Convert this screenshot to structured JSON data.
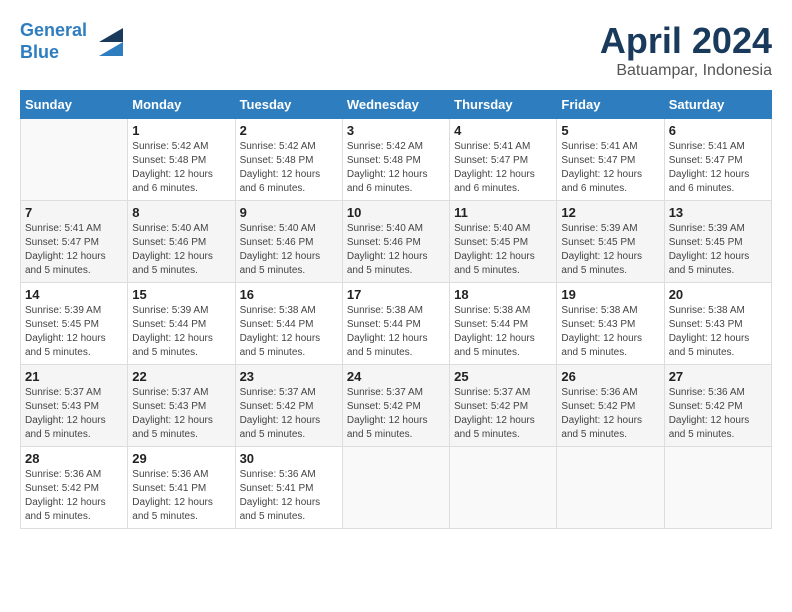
{
  "header": {
    "logo_line1": "General",
    "logo_line2": "Blue",
    "title": "April 2024",
    "subtitle": "Batuampar, Indonesia"
  },
  "columns": [
    "Sunday",
    "Monday",
    "Tuesday",
    "Wednesday",
    "Thursday",
    "Friday",
    "Saturday"
  ],
  "weeks": [
    [
      {
        "day": "",
        "info": ""
      },
      {
        "day": "1",
        "info": "Sunrise: 5:42 AM\nSunset: 5:48 PM\nDaylight: 12 hours\nand 6 minutes."
      },
      {
        "day": "2",
        "info": "Sunrise: 5:42 AM\nSunset: 5:48 PM\nDaylight: 12 hours\nand 6 minutes."
      },
      {
        "day": "3",
        "info": "Sunrise: 5:42 AM\nSunset: 5:48 PM\nDaylight: 12 hours\nand 6 minutes."
      },
      {
        "day": "4",
        "info": "Sunrise: 5:41 AM\nSunset: 5:47 PM\nDaylight: 12 hours\nand 6 minutes."
      },
      {
        "day": "5",
        "info": "Sunrise: 5:41 AM\nSunset: 5:47 PM\nDaylight: 12 hours\nand 6 minutes."
      },
      {
        "day": "6",
        "info": "Sunrise: 5:41 AM\nSunset: 5:47 PM\nDaylight: 12 hours\nand 6 minutes."
      }
    ],
    [
      {
        "day": "7",
        "info": "Sunrise: 5:41 AM\nSunset: 5:47 PM\nDaylight: 12 hours\nand 5 minutes."
      },
      {
        "day": "8",
        "info": "Sunrise: 5:40 AM\nSunset: 5:46 PM\nDaylight: 12 hours\nand 5 minutes."
      },
      {
        "day": "9",
        "info": "Sunrise: 5:40 AM\nSunset: 5:46 PM\nDaylight: 12 hours\nand 5 minutes."
      },
      {
        "day": "10",
        "info": "Sunrise: 5:40 AM\nSunset: 5:46 PM\nDaylight: 12 hours\nand 5 minutes."
      },
      {
        "day": "11",
        "info": "Sunrise: 5:40 AM\nSunset: 5:45 PM\nDaylight: 12 hours\nand 5 minutes."
      },
      {
        "day": "12",
        "info": "Sunrise: 5:39 AM\nSunset: 5:45 PM\nDaylight: 12 hours\nand 5 minutes."
      },
      {
        "day": "13",
        "info": "Sunrise: 5:39 AM\nSunset: 5:45 PM\nDaylight: 12 hours\nand 5 minutes."
      }
    ],
    [
      {
        "day": "14",
        "info": "Sunrise: 5:39 AM\nSunset: 5:45 PM\nDaylight: 12 hours\nand 5 minutes."
      },
      {
        "day": "15",
        "info": "Sunrise: 5:39 AM\nSunset: 5:44 PM\nDaylight: 12 hours\nand 5 minutes."
      },
      {
        "day": "16",
        "info": "Sunrise: 5:38 AM\nSunset: 5:44 PM\nDaylight: 12 hours\nand 5 minutes."
      },
      {
        "day": "17",
        "info": "Sunrise: 5:38 AM\nSunset: 5:44 PM\nDaylight: 12 hours\nand 5 minutes."
      },
      {
        "day": "18",
        "info": "Sunrise: 5:38 AM\nSunset: 5:44 PM\nDaylight: 12 hours\nand 5 minutes."
      },
      {
        "day": "19",
        "info": "Sunrise: 5:38 AM\nSunset: 5:43 PM\nDaylight: 12 hours\nand 5 minutes."
      },
      {
        "day": "20",
        "info": "Sunrise: 5:38 AM\nSunset: 5:43 PM\nDaylight: 12 hours\nand 5 minutes."
      }
    ],
    [
      {
        "day": "21",
        "info": "Sunrise: 5:37 AM\nSunset: 5:43 PM\nDaylight: 12 hours\nand 5 minutes."
      },
      {
        "day": "22",
        "info": "Sunrise: 5:37 AM\nSunset: 5:43 PM\nDaylight: 12 hours\nand 5 minutes."
      },
      {
        "day": "23",
        "info": "Sunrise: 5:37 AM\nSunset: 5:42 PM\nDaylight: 12 hours\nand 5 minutes."
      },
      {
        "day": "24",
        "info": "Sunrise: 5:37 AM\nSunset: 5:42 PM\nDaylight: 12 hours\nand 5 minutes."
      },
      {
        "day": "25",
        "info": "Sunrise: 5:37 AM\nSunset: 5:42 PM\nDaylight: 12 hours\nand 5 minutes."
      },
      {
        "day": "26",
        "info": "Sunrise: 5:36 AM\nSunset: 5:42 PM\nDaylight: 12 hours\nand 5 minutes."
      },
      {
        "day": "27",
        "info": "Sunrise: 5:36 AM\nSunset: 5:42 PM\nDaylight: 12 hours\nand 5 minutes."
      }
    ],
    [
      {
        "day": "28",
        "info": "Sunrise: 5:36 AM\nSunset: 5:42 PM\nDaylight: 12 hours\nand 5 minutes."
      },
      {
        "day": "29",
        "info": "Sunrise: 5:36 AM\nSunset: 5:41 PM\nDaylight: 12 hours\nand 5 minutes."
      },
      {
        "day": "30",
        "info": "Sunrise: 5:36 AM\nSunset: 5:41 PM\nDaylight: 12 hours\nand 5 minutes."
      },
      {
        "day": "",
        "info": ""
      },
      {
        "day": "",
        "info": ""
      },
      {
        "day": "",
        "info": ""
      },
      {
        "day": "",
        "info": ""
      }
    ]
  ]
}
